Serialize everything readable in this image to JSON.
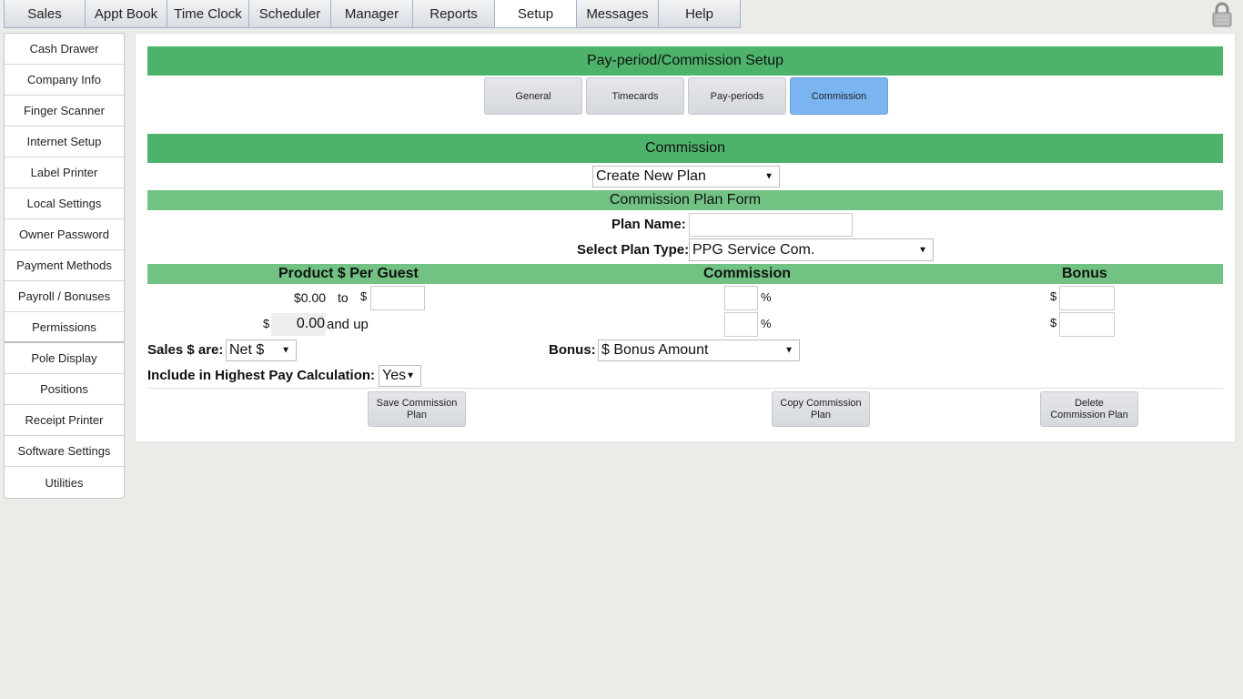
{
  "top_tabs": [
    "Sales",
    "Appt Book",
    "Time Clock",
    "Scheduler",
    "Manager",
    "Reports",
    "Setup",
    "Messages",
    "Help"
  ],
  "active_top_tab": "Setup",
  "sidebar": {
    "items": [
      "Cash Drawer",
      "Company Info",
      "Finger Scanner",
      "Internet Setup",
      "Label Printer",
      "Local Settings",
      "Owner Password",
      "Payment Methods",
      "Payroll / Bonuses",
      "Permissions",
      "Pole Display",
      "Positions",
      "Receipt Printer",
      "Software Settings",
      "Utilities"
    ]
  },
  "main": {
    "title": "Pay-period/Commission Setup",
    "subtabs": [
      "General",
      "Timecards",
      "Pay-periods",
      "Commission"
    ],
    "active_subtab": "Commission",
    "section_title": "Commission",
    "plan_select": "Create New Plan",
    "form_title": "Commission Plan Form",
    "plan_name_label": "Plan Name:",
    "plan_name_value": "",
    "plan_type_label": "Select Plan Type:",
    "plan_type_value": "PPG Service Com.",
    "table_headers": {
      "product": "Product $ Per Guest",
      "commission": "Commission",
      "bonus": "Bonus"
    },
    "tier1": {
      "from": "$0.00",
      "to_label": "to",
      "dollar": "$",
      "percent": "%"
    },
    "tier2": {
      "dollar": "$",
      "from_value": "0.00",
      "and_up": "and up",
      "percent": "%"
    },
    "sales_label": "Sales $ are:",
    "sales_value": "Net $",
    "bonus_label": "Bonus:",
    "bonus_value": "$ Bonus Amount",
    "highest_pay_label": "Include in Highest Pay Calculation:",
    "highest_pay_value": "Yes",
    "buttons": {
      "save": "Save Commission Plan",
      "copy": "Copy Commission Plan",
      "delete": "Delete Commission Plan"
    }
  },
  "colors": {
    "header_green": "#4db36a",
    "form_green": "#72c283",
    "active_blue": "#7ab5f2"
  }
}
